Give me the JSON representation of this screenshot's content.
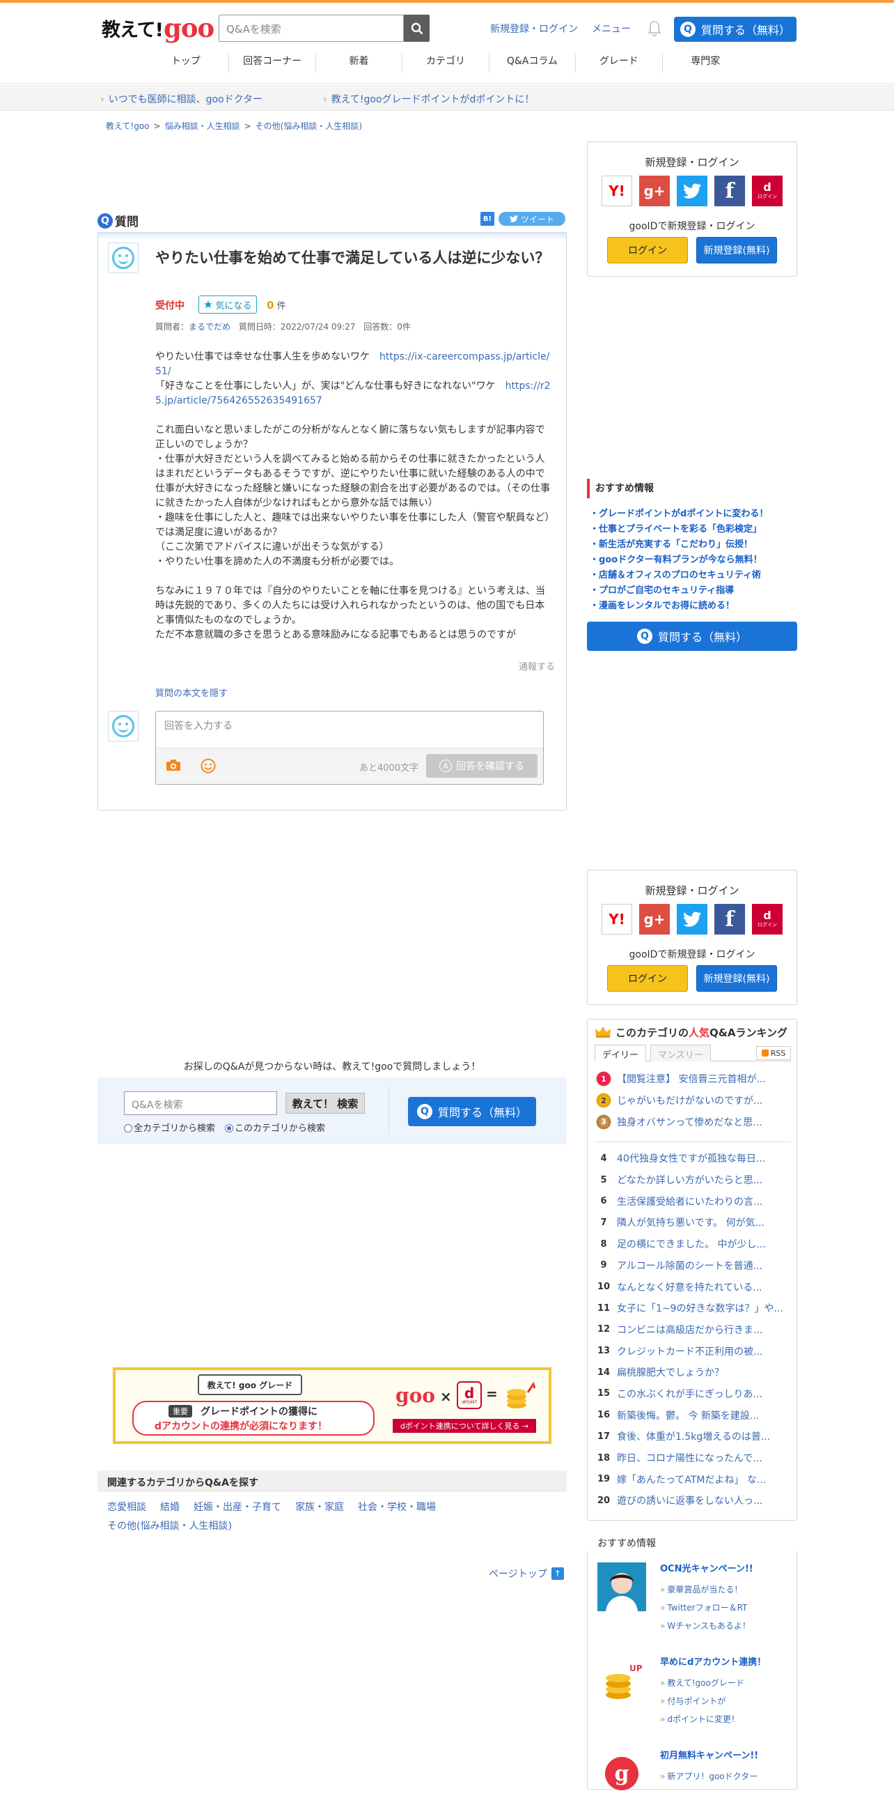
{
  "header": {
    "logo_text": "教えて!",
    "logo_goo": "goo",
    "search_placeholder": "Q&Aを検索",
    "register_login": "新規登録・ログイン",
    "menu": "メニュー",
    "ask_button": "質問する（無料）",
    "q_glyph": "Q",
    "nav": [
      "トップ",
      "回答コーナー",
      "新着",
      "カテゴリ",
      "Q&Aコラム",
      "グレード",
      "専門家"
    ]
  },
  "subbar": {
    "link1": "いつでも医師に相談、gooドクター",
    "link2": "教えて!gooグレードポイントがdポイントに！"
  },
  "breadcrumb": [
    "教えて!goo",
    "悩み相談・人生相談",
    "その他(悩み相談・人生相談)"
  ],
  "breadcrumb_sep": ">",
  "question": {
    "section_label": "質問",
    "hatena": "B!",
    "tweet": "ツイート",
    "title": "やりたい仕事を始めて仕事で満足している人は逆に少ない？",
    "status": "受付中",
    "kininaru": "気になる",
    "kininaru_count": "0",
    "kininaru_unit": "件",
    "meta_author_label": "質問者：",
    "meta_author": "まるでだめ",
    "meta_date": "質問日時：2022/07/24 09:27",
    "meta_answers": "回答数：0件",
    "body_line1_text": "やりたい仕事では幸せな仕事人生を歩めないワケ　",
    "body_line1_link": "https://ix-careercompass.jp/article/51/",
    "body_line2_text": "「好きなことを仕事にしたい人」が、実は\"どんな仕事も好きになれない\"ワケ　",
    "body_line2_link": "https://r25.jp/article/756426552635491657",
    "body_p2": "これ面白いなと思いましたがこの分析がなんとなく腑に落ちない気もしますが記事内容で正しいのでしょうか？\n・仕事が大好きだという人を調べてみると始める前からその仕事に就きたかったという人はまれだというデータもあるそうですが、逆にやりたい仕事に就いた経験のある人の中で仕事が大好きになった経験と嫌いになった経験の割合を出す必要があるのでは。（その仕事に就きたかった人自体が少なければもとから意外な話では無い）\n・趣味を仕事にした人と、趣味では出来ないやりたい事を仕事にした人（警官や駅員など）では満足度に違いがあるか？\n（ここ次第でアドバイスに違いが出そうな気がする）\n・やりたい仕事を諦めた人の不満度も分析が必要では。",
    "body_p3": "ちなみに１９７０年では『自分のやりたいことを軸に仕事を見つける』という考えは、当時は先鋭的であり、多くの人たちには受け入れられなかったというのは、他の国でも日本と事情似たものなのでしょうか。\nただ不本意就職の多さを思うとある意味励みになる記事でもあるとは思うのですが",
    "report": "通報する",
    "hide_body": "質問の本文を隠す"
  },
  "answer_form": {
    "placeholder": "回答を入力する",
    "remaining": "あと4000文字",
    "confirm": "回答を確認する",
    "confirm_glyph": "A"
  },
  "login_box": {
    "title": "新規登録・ログイン",
    "gooid": "gooIDで新規登録・ログイン",
    "login": "ログイン",
    "register": "新規登録(無料)",
    "icons": {
      "yahoo": "Y!",
      "google": "g+",
      "facebook": "f",
      "docomo": "d"
    },
    "docomo_sub": "ログイン"
  },
  "recommend": {
    "title": "おすすめ情報",
    "items": [
      "グレードポイントがdポイントに変わる！",
      "仕事とプライベートを彩る「色彩検定」",
      "新生活が充実する「こだわり」伝授！",
      "gooドクター有料プランが今なら無料！",
      "店舗＆オフィスのプロのセキュリティ術",
      "プロがご自宅のセキュリティ指導",
      "漫画をレンタルでお得に読める！"
    ]
  },
  "ask_side": "質問する（無料）",
  "find": {
    "prompt": "お探しのQ&Aが見つからない時は、教えて!gooで質問しましょう！",
    "placeholder": "Q&Aを検索",
    "button": "教えて！ 検索",
    "radio_all": "全カテゴリから検索",
    "radio_this": "このカテゴリから検索",
    "ask": "質問する（無料）"
  },
  "banner": {
    "grade_label": "教えて! goo グレード",
    "important": "重要",
    "line1": "グレードポイントの獲得に",
    "line2": "dアカウントの連携が必須になります！",
    "goo": "goo",
    "x": "×",
    "dpoint": "dPOINT",
    "eq": "=",
    "cta": "dポイント連携について詳しく見る →"
  },
  "related": {
    "title": "関連するカテゴリからQ&Aを探す",
    "links": [
      "恋愛相談",
      "結婚",
      "妊娠・出産・子育て",
      "家族・家庭",
      "社会・学校・職場",
      "その他(悩み相談・人生相談)"
    ]
  },
  "pagetop": "ページトップ",
  "ranking": {
    "title_pre": "このカテゴリの",
    "title_em": "人気",
    "title_post": "Q&Aランキング",
    "tab_daily": "デイリー",
    "tab_monthly": "マンスリー",
    "rss": "RSS",
    "top": [
      {
        "n": "1",
        "t": "【閲覧注意】 安倍晋三元首相が..."
      },
      {
        "n": "2",
        "t": "じゃがいもだけがないのですが..."
      },
      {
        "n": "3",
        "t": "独身オバサンって惨めだなと思..."
      }
    ],
    "rest": [
      {
        "n": "4",
        "t": "40代独身女性ですが孤独な毎日..."
      },
      {
        "n": "5",
        "t": "どなたか詳しい方がいたらと思..."
      },
      {
        "n": "6",
        "t": "生活保護受給者にいたわりの言..."
      },
      {
        "n": "7",
        "t": "隣人が気持ち悪いです。 何が気..."
      },
      {
        "n": "8",
        "t": "足の横にできました。 中が少し..."
      },
      {
        "n": "9",
        "t": "アルコール除菌のシートを普通..."
      },
      {
        "n": "10",
        "t": "なんとなく好意を持たれている..."
      },
      {
        "n": "11",
        "t": "女子に「1~9の好きな数字は？」や..."
      },
      {
        "n": "12",
        "t": "コンビニは高級店だから行きま..."
      },
      {
        "n": "13",
        "t": "クレジットカード不正利用の被..."
      },
      {
        "n": "14",
        "t": "扁桃腺肥大でしょうか？"
      },
      {
        "n": "15",
        "t": "この水ぶくれが手にぎっしりあ..."
      },
      {
        "n": "16",
        "t": "新築後悔。鬱。 今 新築を建設..."
      },
      {
        "n": "17",
        "t": "食後、体重が1.5kg増えるのは普..."
      },
      {
        "n": "18",
        "t": "昨日、コロナ陽性になったんで..."
      },
      {
        "n": "19",
        "t": "嫁「あんたってATMだよね」 な..."
      },
      {
        "n": "20",
        "t": "遊びの誘いに返事をしない人っ..."
      }
    ]
  },
  "osusume": {
    "title": "おすすめ情報",
    "items": [
      {
        "h": "OCN光キャンペーン!!",
        "l": [
          "豪華賞品が当たる！",
          "Twitterフォロー＆RT",
          "Wチャンスもあるよ！"
        ]
      },
      {
        "h": "早めにdアカウント連携！",
        "l": [
          "教えて!gooグレード",
          "付与ポイントが",
          "dポイントに変更！"
        ]
      },
      {
        "h": "初月無料キャンペーン!!",
        "l": [
          "新アプリ！gooドクター"
        ]
      }
    ],
    "up_label": "UP"
  }
}
